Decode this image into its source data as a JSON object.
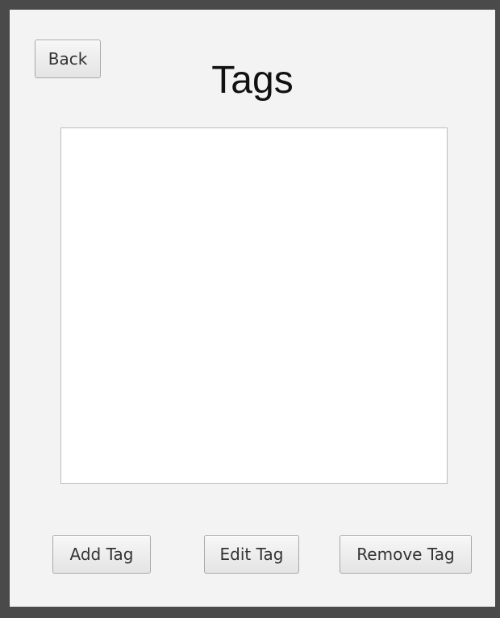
{
  "window": {
    "title": "Tags"
  },
  "toolbar": {
    "back_label": "Back"
  },
  "tag_list": {
    "items": []
  },
  "actions": {
    "add_label": "Add Tag",
    "edit_label": "Edit Tag",
    "remove_label": "Remove Tag"
  }
}
